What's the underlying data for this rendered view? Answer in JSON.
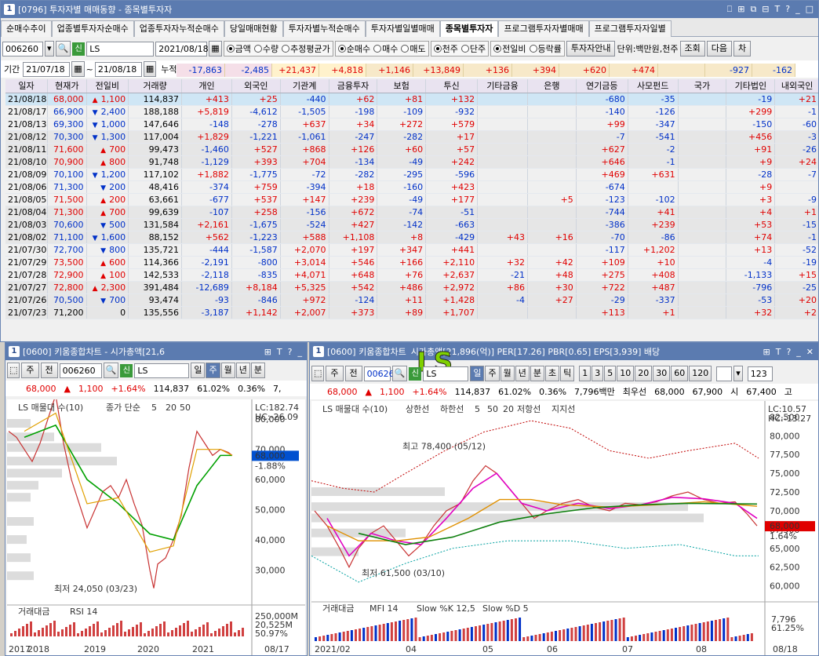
{
  "top": {
    "title_num": "1",
    "title": "[0796] 투자자별 매매동향 - 종목별투자자",
    "title_ctl": [
      "⎕",
      "⊞",
      "⧉",
      "⊟",
      "T",
      "?",
      "_",
      "□"
    ],
    "tabs": [
      "순매수추이",
      "업종별투자자순매수",
      "업종투자자누적순매수",
      "당일매매현황",
      "투자자별누적순매수",
      "투자자별일별매매",
      "종목별투자자",
      "프로그램투자자별매매",
      "프로그램투자자일별"
    ],
    "active_tab": 6,
    "code": "006260",
    "sin": "신",
    "name": "LS",
    "date": "2021/08/18",
    "radio_group1": [
      "금액",
      "수량",
      "추정평균가"
    ],
    "radio_group2": [
      "순매수",
      "매수",
      "매도"
    ],
    "radio_group3": [
      "천주",
      "단주"
    ],
    "radio_group4": [
      "전일비",
      "등락률"
    ],
    "guide_btn": "투자자안내",
    "unit": "단위:백만원,천주",
    "query_btn": "조회",
    "next_btn": "다음",
    "extra_btn": "차",
    "period_label": "기간",
    "date_from": "21/07/18",
    "tilde": "~",
    "date_to": "21/08/18",
    "cum_label": "누적순매수",
    "cum_values": [
      "-17,863",
      "-2,485",
      "+21,437",
      "+4,818",
      "+1,146",
      "+13,849",
      "+136",
      "+394",
      "+620",
      "+474",
      "",
      "-927",
      "-162"
    ],
    "headers": [
      "일자",
      "현재가",
      "전일비",
      "거래량",
      "개인",
      "외국인",
      "기관계",
      "금융투자",
      "보험",
      "투신",
      "기타금융",
      "은행",
      "연기금등",
      "사모펀드",
      "국가",
      "기타법인",
      "내외국인"
    ],
    "rows": [
      [
        "21/08/18",
        "68,000",
        "up",
        "1,100",
        "114,837",
        "+413",
        "+25",
        "-440",
        "+62",
        "+81",
        "+132",
        "",
        "",
        "-680",
        "-35",
        "",
        "-19",
        "+21"
      ],
      [
        "21/08/17",
        "66,900",
        "dn",
        "2,400",
        "188,188",
        "+5,819",
        "-4,612",
        "-1,505",
        "-198",
        "-109",
        "-932",
        "",
        "",
        "-140",
        "-126",
        "",
        "+299",
        "-1"
      ],
      [
        "21/08/13",
        "69,300",
        "dn",
        "1,000",
        "147,646",
        "-148",
        "-278",
        "+637",
        "+34",
        "+272",
        "+579",
        "",
        "",
        "+99",
        "-347",
        "",
        "-150",
        "-60"
      ],
      [
        "21/08/12",
        "70,300",
        "dn",
        "1,300",
        "117,004",
        "+1,829",
        "-1,221",
        "-1,061",
        "-247",
        "-282",
        "+17",
        "",
        "",
        "-7",
        "-541",
        "",
        "+456",
        "-3"
      ],
      [
        "21/08/11",
        "71,600",
        "up",
        "700",
        "99,473",
        "-1,460",
        "+527",
        "+868",
        "+126",
        "+60",
        "+57",
        "",
        "",
        "+627",
        "-2",
        "",
        "+91",
        "-26"
      ],
      [
        "21/08/10",
        "70,900",
        "up",
        "800",
        "91,748",
        "-1,129",
        "+393",
        "+704",
        "-134",
        "-49",
        "+242",
        "",
        "",
        "+646",
        "-1",
        "",
        "+9",
        "+24"
      ],
      [
        "21/08/09",
        "70,100",
        "dn",
        "1,200",
        "117,102",
        "+1,882",
        "-1,775",
        "-72",
        "-282",
        "-295",
        "-596",
        "",
        "",
        "+469",
        "+631",
        "",
        "-28",
        "-7"
      ],
      [
        "21/08/06",
        "71,300",
        "dn",
        "200",
        "48,416",
        "-374",
        "+759",
        "-394",
        "+18",
        "-160",
        "+423",
        "",
        "",
        "-674",
        "",
        "",
        "+9",
        ""
      ],
      [
        "21/08/05",
        "71,500",
        "up",
        "200",
        "63,661",
        "-677",
        "+537",
        "+147",
        "+239",
        "-49",
        "+177",
        "",
        "+5",
        "-123",
        "-102",
        "",
        "+3",
        "-9"
      ],
      [
        "21/08/04",
        "71,300",
        "up",
        "700",
        "99,639",
        "-107",
        "+258",
        "-156",
        "+672",
        "-74",
        "-51",
        "",
        "",
        "-744",
        "+41",
        "",
        "+4",
        "+1"
      ],
      [
        "21/08/03",
        "70,600",
        "dn",
        "500",
        "131,584",
        "+2,161",
        "-1,675",
        "-524",
        "+427",
        "-142",
        "-663",
        "",
        "",
        "-386",
        "+239",
        "",
        "+53",
        "-15"
      ],
      [
        "21/08/02",
        "71,100",
        "dn",
        "1,600",
        "88,152",
        "+562",
        "-1,223",
        "+588",
        "+1,108",
        "+8",
        "-429",
        "+43",
        "+16",
        "-70",
        "-86",
        "",
        "+74",
        "-1"
      ],
      [
        "21/07/30",
        "72,700",
        "dn",
        "800",
        "135,721",
        "-444",
        "-1,587",
        "+2,070",
        "+197",
        "+347",
        "+441",
        "",
        "",
        "-117",
        "+1,202",
        "",
        "+13",
        "-52"
      ],
      [
        "21/07/29",
        "73,500",
        "up",
        "600",
        "114,366",
        "-2,191",
        "-800",
        "+3,014",
        "+546",
        "+166",
        "+2,110",
        "+32",
        "+42",
        "+109",
        "+10",
        "",
        "-4",
        "-19"
      ],
      [
        "21/07/28",
        "72,900",
        "up",
        "100",
        "142,533",
        "-2,118",
        "-835",
        "+4,071",
        "+648",
        "+76",
        "+2,637",
        "-21",
        "+48",
        "+275",
        "+408",
        "",
        "-1,133",
        "+15"
      ],
      [
        "21/07/27",
        "72,800",
        "up",
        "2,300",
        "391,484",
        "-12,689",
        "+8,184",
        "+5,325",
        "+542",
        "+486",
        "+2,972",
        "+86",
        "+30",
        "+722",
        "+487",
        "",
        "-796",
        "-25"
      ],
      [
        "21/07/26",
        "70,500",
        "dn",
        "700",
        "93,474",
        "-93",
        "-846",
        "+972",
        "-124",
        "+11",
        "+1,428",
        "-4",
        "+27",
        "-29",
        "-337",
        "",
        "-53",
        "+20"
      ],
      [
        "21/07/23",
        "71,200",
        "",
        "0",
        "135,556",
        "-3,187",
        "+1,142",
        "+2,007",
        "+373",
        "+89",
        "+1,707",
        "",
        "",
        "+113",
        "+1",
        "",
        "+32",
        "+2"
      ]
    ]
  },
  "left_chart": {
    "title_num": "1",
    "title": "[0600] 키움종합차트 - 시가총액[21,6",
    "title_ctl": [
      "⊞",
      "T",
      "?",
      "_"
    ],
    "tb": [
      "주",
      "전"
    ],
    "code": "006260",
    "sin": "신",
    "name": "LS",
    "periods": [
      "일",
      "주",
      "월",
      "년",
      "분"
    ],
    "period_active": 1,
    "info": [
      "68,000",
      "▲",
      "1,100",
      "+1.64%",
      "114,837",
      "61.02%",
      "0.36%",
      "7,"
    ],
    "legend_name": "LS 매물대 수(10)",
    "legend_ma": "종가 단순",
    "legend_ma_vals": [
      "5",
      "20",
      "50"
    ],
    "lc": "LC:182.74",
    "hc": "HC:-26.09",
    "price_now": "68,000",
    "price_pct": "-1.88%",
    "high_label": "최고 92,000 (05/28)",
    "low_label": "최저 24,050 (03/23)",
    "y_ticks": [
      "80,000",
      "70,000",
      "60,000",
      "50,000",
      "40,000",
      "30,000"
    ],
    "sub_legend": "거래대금",
    "sub_rsi": "RSI 14",
    "sub_vals": [
      "250,000M",
      "20,525M",
      "50.97%"
    ],
    "x_ticks": [
      "2017",
      "2018",
      "2019",
      "2020",
      "2021"
    ],
    "date_end": "08/17"
  },
  "right_chart": {
    "title_num": "1",
    "title": "[0600] 키움종합차트",
    "title_rest": "시가총액[21,896(억)] PER[17.26] PBR[0.65] EPS[3,939] 배당",
    "title_ctl": [
      "⊞",
      "T",
      "?",
      "_",
      "✕"
    ],
    "overlay": "LS",
    "tb": [
      "주",
      "전"
    ],
    "code": "00626",
    "sin": "신",
    "name": "LS",
    "periods": [
      "일",
      "주",
      "월",
      "년",
      "분",
      "초",
      "틱"
    ],
    "period_active": 0,
    "numbers": [
      "1",
      "3",
      "5",
      "10",
      "20",
      "30",
      "60",
      "120"
    ],
    "page": "123",
    "info": [
      "68,000",
      "▲",
      "1,100",
      "+1.64%",
      "114,837",
      "61.02%",
      "0.36%",
      "7,796백만",
      "최우선",
      "68,000",
      "67,900",
      "시",
      "67,400",
      "고"
    ],
    "legend_name": "LS 매물대 수(10)",
    "legend_items": [
      "상한선",
      "하한선",
      "5",
      "50",
      "20",
      "저항선",
      "지지선"
    ],
    "lc": "LC:10.57",
    "hc": "HC:-13.27",
    "price_now": "68,000",
    "price_pct": "1.64%",
    "high_label": "최고 78,400 (05/12)",
    "low_label": "최저 61,500 (03/10)",
    "y_ticks": [
      "82,500",
      "80,000",
      "77,500",
      "75,000",
      "72,500",
      "70,000",
      "67,500",
      "65,000",
      "62,500",
      "60,000"
    ],
    "sub_legend": "거래대금",
    "sub_items": [
      "MFI 14",
      "Slow %K 12,5",
      "Slow %D 5"
    ],
    "sub_vals": [
      "7,796",
      "61.25%"
    ],
    "x_ticks": [
      "2021/02",
      "04",
      "05",
      "06",
      "07",
      "08"
    ],
    "date_end": "08/18"
  },
  "colors": {
    "up": "#e00000",
    "down": "#0030c8",
    "ma5": "#e0a000",
    "ma20": "#00a000",
    "ma50": "#007000",
    "title": "#5b7bb0"
  }
}
